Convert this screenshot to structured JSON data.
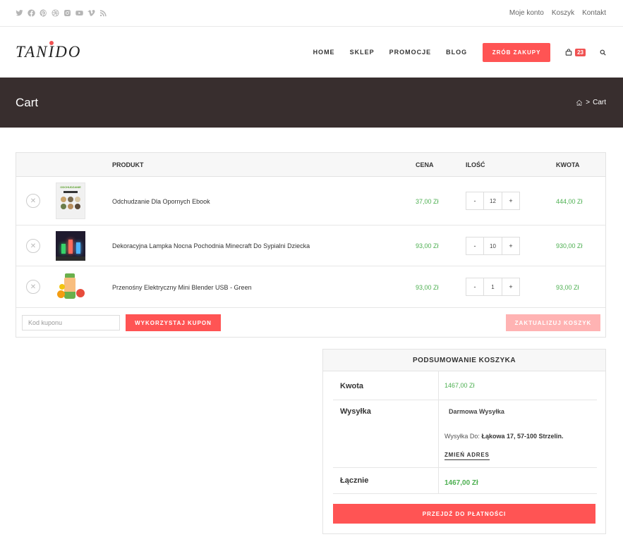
{
  "topbar": {
    "social_icons": [
      "twitter-icon",
      "facebook-icon",
      "pinterest-icon",
      "dribbble-icon",
      "instagram-icon",
      "youtube-icon",
      "vimeo-icon",
      "rss-icon"
    ],
    "links": [
      "Moje konto",
      "Koszyk",
      "Kontakt"
    ]
  },
  "header": {
    "logo": "TANIDO",
    "nav": [
      "HOME",
      "SKLEP",
      "PROMOCJE",
      "BLOG"
    ],
    "cta": "ZRÓB ZAKUPY",
    "cart_count": "23"
  },
  "page": {
    "title": "Cart",
    "breadcrumb_current": "Cart"
  },
  "cart": {
    "headers": {
      "product": "PRODUKT",
      "price": "CENA",
      "qty": "ILOŚĆ",
      "subtotal": "KWOTA"
    },
    "items": [
      {
        "name": "Odchudzanie Dla Opornych Ebook",
        "price": "37,00 Zł",
        "qty": "12",
        "subtotal": "444,00 Zł",
        "thumb_caption": "ODCHUDZANIE"
      },
      {
        "name": "Dekoracyjna Lampka Nocna Pochodnia Minecraft Do Sypialni Dziecka",
        "price": "93,00 Zł",
        "qty": "10",
        "subtotal": "930,00 Zł"
      },
      {
        "name": "Przenośny Elektryczny Mini Blender USB - Green",
        "price": "93,00 Zł",
        "qty": "1",
        "subtotal": "93,00 Zł"
      }
    ],
    "minus": "-",
    "plus": "+",
    "remove": "✕",
    "coupon_placeholder": "Kod kuponu",
    "apply_coupon": "WYKORZYSTAJ KUPON",
    "update_cart": "ZAKTUALIZUJ KOSZYK"
  },
  "totals": {
    "title": "PODSUMOWANIE KOSZYKA",
    "subtotal_label": "Kwota",
    "subtotal_value": "1467,00 Zł",
    "shipping_label": "Wysyłka",
    "shipping_method": "Darmowa Wysyłka",
    "shipping_to_prefix": "Wysyłka Do:",
    "shipping_address": "Łąkowa 17, 57-100 Strzelin.",
    "change_address": "ZMIEŃ ADRES",
    "total_label": "Łącznie",
    "total_value": "1467,00 Zł",
    "checkout": "PRZEJDŹ DO PŁATNOŚCI"
  },
  "colors": {
    "accent": "#ff5454",
    "price_green": "#4caf50",
    "title_bar": "#382e2e"
  }
}
